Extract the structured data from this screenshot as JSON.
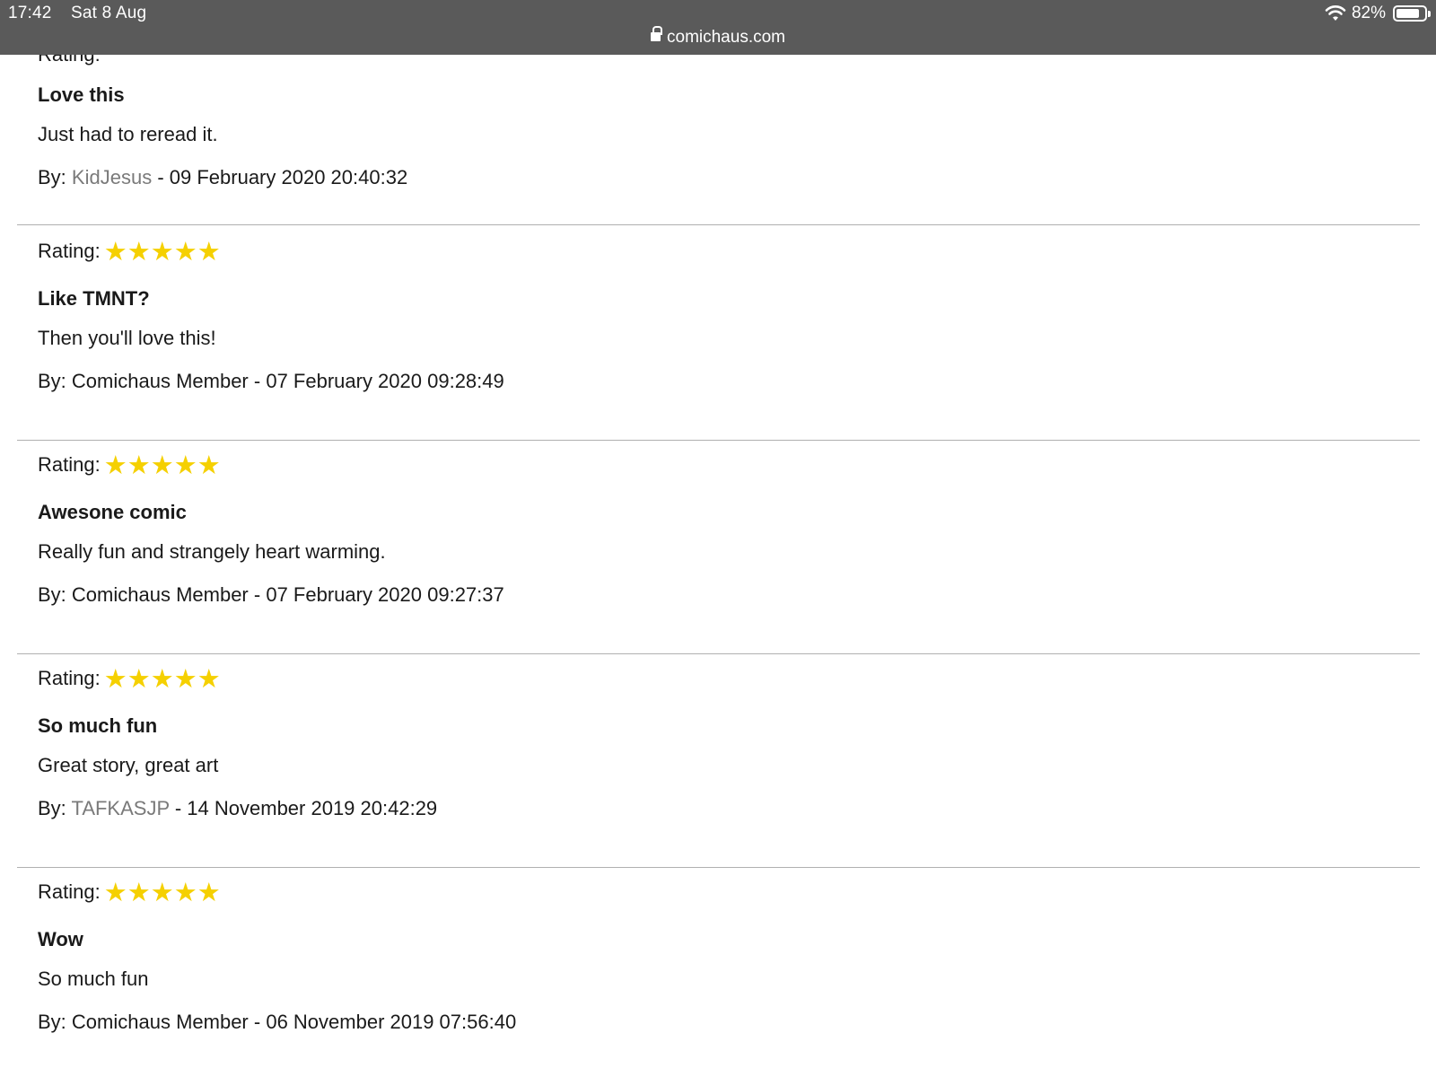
{
  "status_bar": {
    "time": "17:42",
    "date": "Sat 8 Aug",
    "battery": "82%",
    "battery_level": 0.82,
    "url": "comichaus.com"
  },
  "labels": {
    "rating": "Rating:",
    "by": "By:",
    "separator": " - "
  },
  "star_color": "#f5d000",
  "link_color": "#7a7a7a",
  "reviews": [
    {
      "title": "Love this",
      "body": "Just had to reread it.",
      "author": "KidJesus",
      "author_is_link": true,
      "date": "09 February 2020 20:40:32"
    },
    {
      "rating": 5,
      "stars": "★★★★★",
      "title": "Like TMNT?",
      "body": "Then you'll love this!",
      "author": "Comichaus Member",
      "author_is_link": false,
      "date": "07 February 2020 09:28:49"
    },
    {
      "rating": 5,
      "stars": "★★★★★",
      "title": "Awesone comic",
      "body": "Really fun and strangely heart warming.",
      "author": "Comichaus Member",
      "author_is_link": false,
      "date": "07 February 2020 09:27:37"
    },
    {
      "rating": 5,
      "stars": "★★★★★",
      "title": "So much fun",
      "body": "Great story, great art",
      "author": "TAFKASJP",
      "author_is_link": true,
      "date": "14 November 2019 20:42:29"
    },
    {
      "rating": 5,
      "stars": "★★★★★",
      "title": "Wow",
      "body": "So much fun",
      "author": "Comichaus Member",
      "author_is_link": false,
      "date": "06 November 2019 07:56:40"
    }
  ]
}
